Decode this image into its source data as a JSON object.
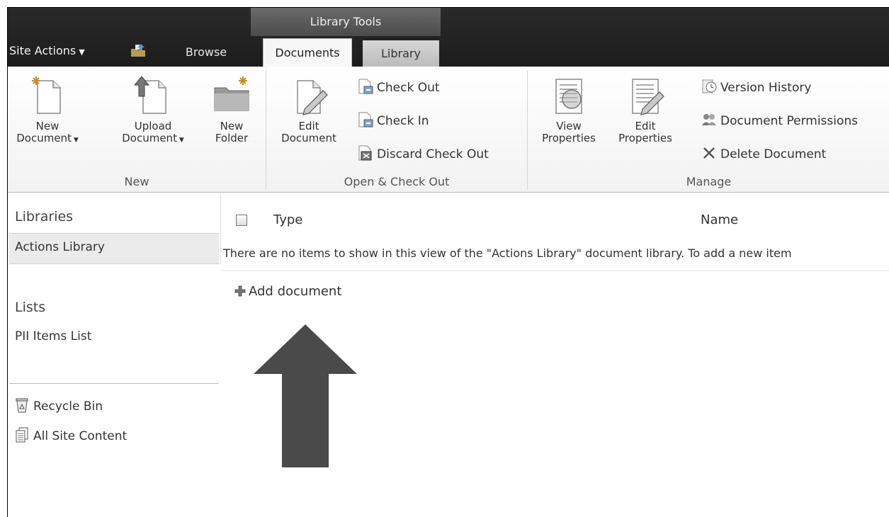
{
  "ribbon_context": {
    "header": "Library Tools"
  },
  "topnav": {
    "site_actions": "Site Actions",
    "tabs": [
      {
        "label": "Browse"
      },
      {
        "label": "Documents"
      },
      {
        "label": "Library"
      }
    ]
  },
  "groups": {
    "new": {
      "label": "New",
      "buttons": [
        {
          "line1": "New",
          "line2": "Document",
          "dropdown": true,
          "icon": "new-document-icon"
        },
        {
          "line1": "Upload",
          "line2": "Document",
          "dropdown": true,
          "icon": "upload-document-icon"
        },
        {
          "line1": "New",
          "line2": "Folder",
          "dropdown": false,
          "icon": "new-folder-icon"
        }
      ]
    },
    "open": {
      "label": "Open & Check Out",
      "big": {
        "line1": "Edit",
        "line2": "Document",
        "icon": "edit-document-icon"
      },
      "small": [
        {
          "label": "Check Out",
          "icon": "check-out-icon"
        },
        {
          "label": "Check In",
          "icon": "check-in-icon"
        },
        {
          "label": "Discard Check Out",
          "icon": "discard-check-out-icon"
        }
      ]
    },
    "manage": {
      "label": "Manage",
      "big": [
        {
          "line1": "View",
          "line2": "Properties",
          "icon": "view-properties-icon"
        },
        {
          "line1": "Edit",
          "line2": "Properties",
          "icon": "edit-properties-icon"
        }
      ],
      "small": [
        {
          "label": "Version History",
          "icon": "version-history-icon"
        },
        {
          "label": "Document Permissions",
          "icon": "document-permissions-icon"
        },
        {
          "label": "Delete Document",
          "icon": "delete-icon"
        }
      ]
    }
  },
  "leftnav": {
    "libraries_heading": "Libraries",
    "libraries": [
      "Actions Library"
    ],
    "lists_heading": "Lists",
    "lists": [
      "PII Items List"
    ],
    "recycle_bin": "Recycle Bin",
    "all_site_content": "All Site Content"
  },
  "list": {
    "columns": [
      "Type",
      "Name"
    ],
    "empty_message": "There are no items to show in this view of the \"Actions Library\" document library. To add a new item",
    "add_document": "Add document"
  },
  "colors": {
    "topbar": "#1f1f1f",
    "context_tab": "#5a5a5a",
    "arrow": "#4a4a4a"
  }
}
